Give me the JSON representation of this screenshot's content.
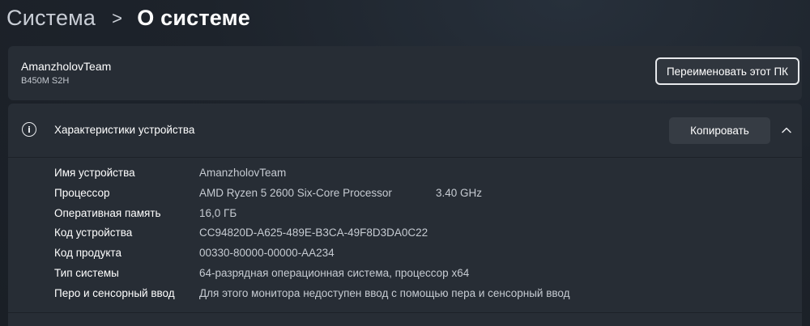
{
  "breadcrumb": {
    "parent": "Система",
    "separator": ">",
    "current": "О системе"
  },
  "device_card": {
    "name": "AmanzholovTeam",
    "model": "B450M S2H",
    "rename_button": "Переименовать этот ПК"
  },
  "specs": {
    "title": "Характеристики устройства",
    "copy_button": "Копировать",
    "icons": {
      "info": "info-icon",
      "collapse": "chevron-up-icon"
    },
    "rows": [
      {
        "label": "Имя устройства",
        "value": "AmanzholovTeam",
        "extra": ""
      },
      {
        "label": "Процессор",
        "value": "AMD Ryzen 5 2600 Six-Core Processor",
        "extra": "3.40 GHz"
      },
      {
        "label": "Оперативная память",
        "value": "16,0 ГБ",
        "extra": ""
      },
      {
        "label": "Код устройства",
        "value": "CC94820D-A625-489E-B3CA-49F8D3DA0C22",
        "extra": ""
      },
      {
        "label": "Код продукта",
        "value": "00330-80000-00000-AA234",
        "extra": ""
      },
      {
        "label": "Тип системы",
        "value": "64-разрядная операционная система, процессор x64",
        "extra": ""
      },
      {
        "label": "Перо и сенсорный ввод",
        "value": "Для этого монитора недоступен ввод с помощью пера и сенсорный ввод",
        "extra": ""
      }
    ]
  },
  "colors": {
    "background": "#1c2128",
    "card": "#272d35",
    "secondary_text": "#c6cbd2"
  }
}
